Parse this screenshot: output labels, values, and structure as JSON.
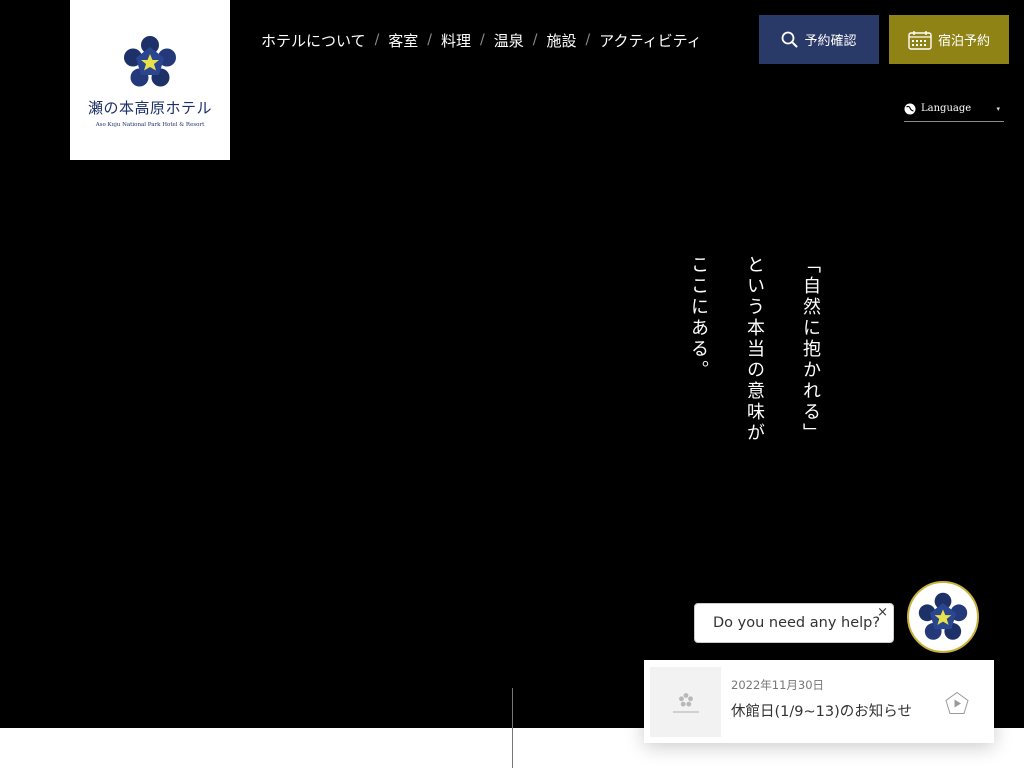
{
  "logo": {
    "name": "瀬の本高原ホテル",
    "subtitle": "Aso Kuju National Park Hotel & Resort"
  },
  "nav": {
    "items": [
      {
        "label": "ホテルについて"
      },
      {
        "label": "客室"
      },
      {
        "label": "料理"
      },
      {
        "label": "温泉"
      },
      {
        "label": "施設"
      },
      {
        "label": "アクティビティ"
      }
    ],
    "separator": "/"
  },
  "buttons": {
    "confirm": "予約確認",
    "book": "宿泊予約"
  },
  "language": {
    "label": "Language",
    "caret": "▾"
  },
  "hero_copy": {
    "line1": "「自然に抱かれる」",
    "line2": "という本当の意味が",
    "line3": "ここにある。"
  },
  "chat": {
    "prompt": "Do you need any help?",
    "close": "×"
  },
  "news": {
    "date": "2022年11月30日",
    "title": "休館日(1/9~13)のお知らせ"
  },
  "colors": {
    "navy": "#1e3068",
    "confirm_button": "#2a3a68",
    "book_button": "#8f8316",
    "star_yellow": "#e9e24a",
    "hero_bg": "#000000"
  },
  "icons": {
    "confirm": "search-icon",
    "book": "calendar-icon",
    "language": "globe-icon",
    "news_arrow": "pentagon-arrow-icon"
  }
}
